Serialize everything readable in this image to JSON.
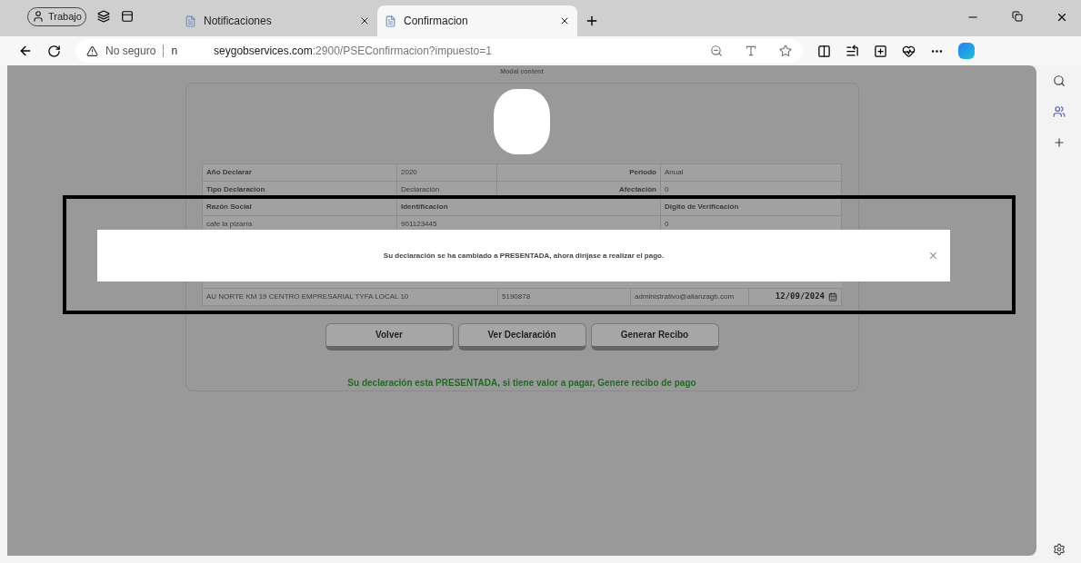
{
  "browser": {
    "profile": "Trabajo",
    "tabs": [
      {
        "title": "Notificaciones",
        "selected": false
      },
      {
        "title": "Confirmacion",
        "selected": true
      }
    ],
    "address": {
      "security": "No seguro",
      "fragment": "n",
      "host": "seygobservices.com",
      "path": ":2900/PSEConfirmacion?impuesto=1"
    }
  },
  "page": {
    "modal_label": "Modal content",
    "table": {
      "rows": [
        {
          "kind": "pair",
          "cells": [
            "Año Declarar",
            "2020",
            "Periodo",
            "Anual"
          ]
        },
        {
          "kind": "pair",
          "cells": [
            "Tipo Declaracion",
            "Declaración",
            "Afectación",
            "0"
          ]
        },
        {
          "kind": "header",
          "cells": [
            "Razón Social",
            "Identificacion",
            "Digito de Verificación"
          ]
        },
        {
          "kind": "plain",
          "cells": [
            "cafe la pizarra",
            "901123445",
            "0"
          ]
        },
        {
          "kind": "hidden",
          "cells": []
        },
        {
          "kind": "contact",
          "cells": [
            "AU NORTE KM 19 CENTRO EMPRESARIAL TYFA LOCAL 10",
            "5190878",
            "administrativo@alianzagb.com",
            "12/09/2024"
          ]
        }
      ]
    },
    "buttons": [
      "Volver",
      "Ver Declaración",
      "Generar Recibo"
    ],
    "status": "Su declaración esta PRESENTADA, si tiene valor a pagar, Genere recibo de pago"
  },
  "toast": {
    "message": "Su declaración se ha cambiado a PRESENTADA, ahora diríjase a realizar el pago.",
    "close": "×"
  }
}
